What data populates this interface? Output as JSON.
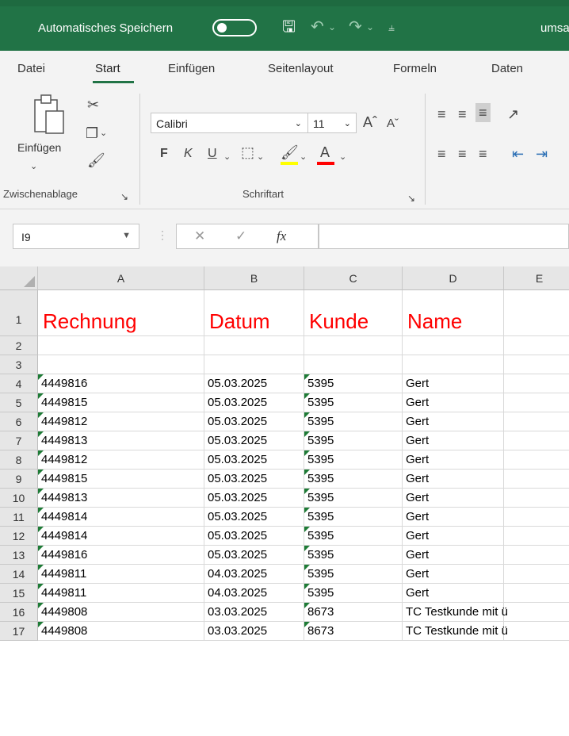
{
  "titlebar": {
    "autosave_label": "Automatisches Speichern",
    "filename": "umsat"
  },
  "tabs": [
    "Datei",
    "Start",
    "Einfügen",
    "Seitenlayout",
    "Formeln",
    "Daten"
  ],
  "ribbon": {
    "paste_label": "Einfügen",
    "font_name": "Calibri",
    "font_size": "11",
    "bold": "F",
    "italic": "K",
    "underline": "U",
    "group_clipboard": "Zwischenablage",
    "group_font": "Schriftart"
  },
  "formula_bar": {
    "name_box": "I9",
    "fx": "fx",
    "content": ""
  },
  "sheet": {
    "columns": [
      "A",
      "B",
      "C",
      "D",
      "E"
    ],
    "rows": [
      {
        "n": "1",
        "a": "Rechnung",
        "b": "Datum",
        "c": "Kunde",
        "d": "Name",
        "e": ""
      },
      {
        "n": "2",
        "a": "",
        "b": "",
        "c": "",
        "d": "",
        "e": ""
      },
      {
        "n": "3",
        "a": "",
        "b": "",
        "c": "",
        "d": "",
        "e": ""
      },
      {
        "n": "4",
        "a": "4449816",
        "b": "05.03.2025",
        "c": "5395",
        "d": "Gert",
        "e": ""
      },
      {
        "n": "5",
        "a": "4449815",
        "b": "05.03.2025",
        "c": "5395",
        "d": "Gert",
        "e": ""
      },
      {
        "n": "6",
        "a": "4449812",
        "b": "05.03.2025",
        "c": "5395",
        "d": "Gert",
        "e": ""
      },
      {
        "n": "7",
        "a": "4449813",
        "b": "05.03.2025",
        "c": "5395",
        "d": "Gert",
        "e": ""
      },
      {
        "n": "8",
        "a": "4449812",
        "b": "05.03.2025",
        "c": "5395",
        "d": "Gert",
        "e": ""
      },
      {
        "n": "9",
        "a": "4449815",
        "b": "05.03.2025",
        "c": "5395",
        "d": "Gert",
        "e": ""
      },
      {
        "n": "10",
        "a": "4449813",
        "b": "05.03.2025",
        "c": "5395",
        "d": "Gert",
        "e": ""
      },
      {
        "n": "11",
        "a": "4449814",
        "b": "05.03.2025",
        "c": "5395",
        "d": "Gert",
        "e": ""
      },
      {
        "n": "12",
        "a": "4449814",
        "b": "05.03.2025",
        "c": "5395",
        "d": "Gert",
        "e": ""
      },
      {
        "n": "13",
        "a": "4449816",
        "b": "05.03.2025",
        "c": "5395",
        "d": "Gert",
        "e": ""
      },
      {
        "n": "14",
        "a": "4449811",
        "b": "04.03.2025",
        "c": "5395",
        "d": "Gert",
        "e": ""
      },
      {
        "n": "15",
        "a": "4449811",
        "b": "04.03.2025",
        "c": "5395",
        "d": "Gert",
        "e": ""
      },
      {
        "n": "16",
        "a": "4449808",
        "b": "03.03.2025",
        "c": "8673",
        "d": "TC Testkunde mit ü",
        "e": ""
      },
      {
        "n": "17",
        "a": "4449808",
        "b": "03.03.2025",
        "c": "8673",
        "d": "TC Testkunde mit ü",
        "e": ""
      }
    ]
  },
  "colors": {
    "excel_green": "#217346",
    "header_red": "#ff0000",
    "highlight_yellow": "#ffff00",
    "font_red": "#ff0000"
  }
}
